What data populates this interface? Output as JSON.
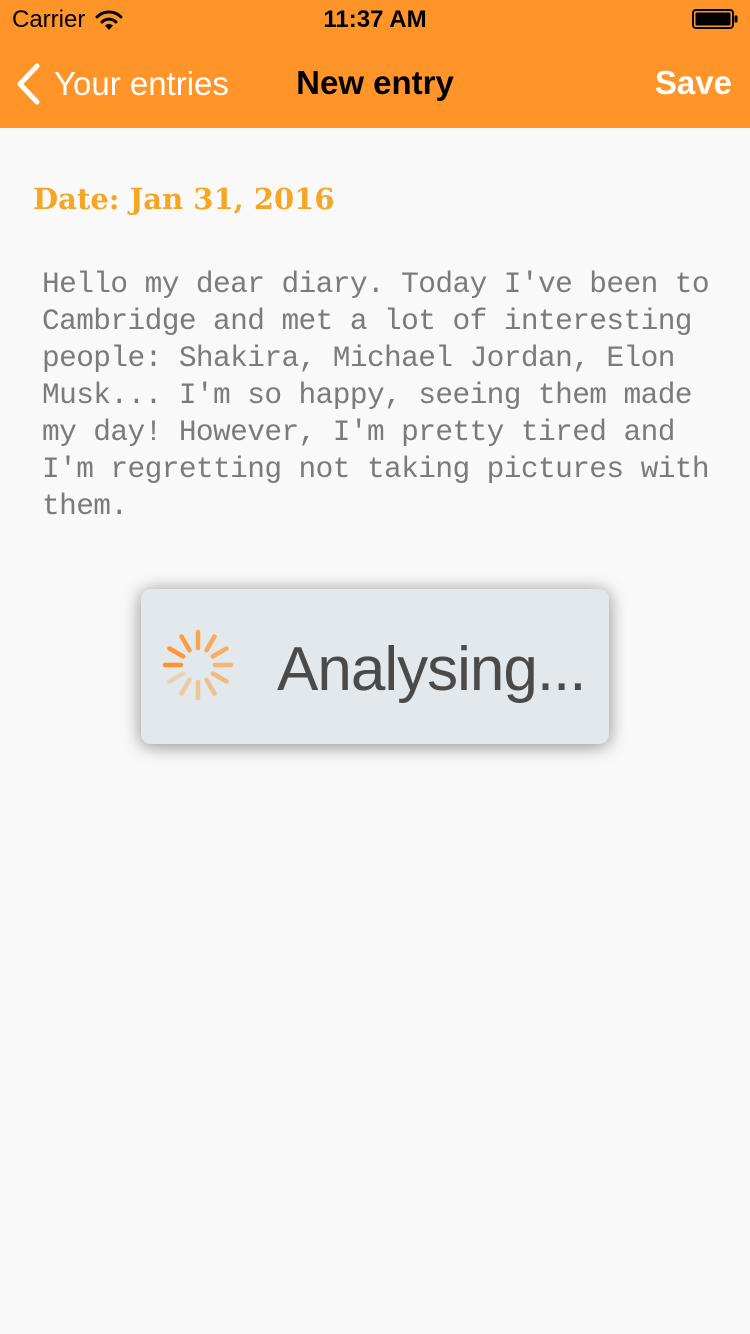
{
  "status_bar": {
    "carrier": "Carrier",
    "time": "11:37 AM"
  },
  "nav": {
    "back_label": "Your entries",
    "title": "New entry",
    "save_label": "Save"
  },
  "entry": {
    "date_label": "Date: Jan 31, 2016",
    "text": "Hello my dear diary. Today I've been to Cambridge and met a lot of interesting people: Shakira, Michael Jordan, Elon Musk... I'm so happy, seeing them made my day! However, I'm pretty tired and I'm regretting not taking pictures with them."
  },
  "hud": {
    "message": "Analysing..."
  },
  "colors": {
    "accent": "#ff9428",
    "date": "#f5a623",
    "background": "#f9f9f9",
    "hud_background": "#e3e8ec"
  }
}
